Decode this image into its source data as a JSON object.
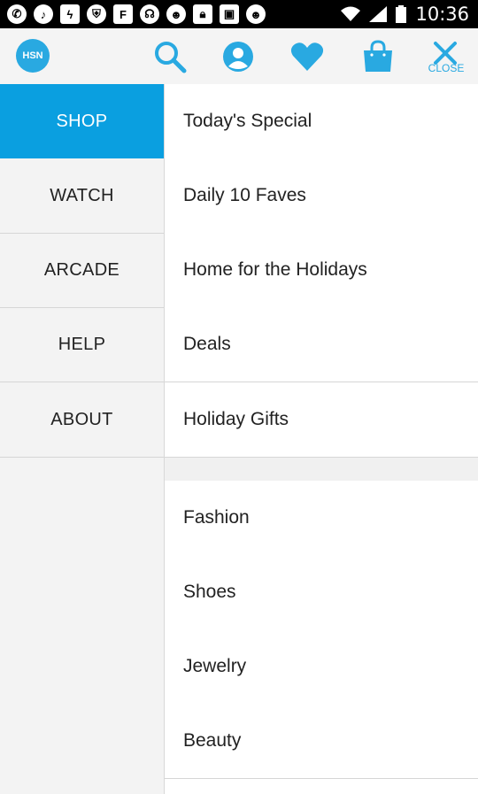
{
  "status_bar": {
    "time": "10:36",
    "notification_icons": [
      "whatsapp-icon",
      "music-icon",
      "bolt-icon",
      "shield-icon",
      "flipboard-icon",
      "headset-icon",
      "bot-icon",
      "lock-icon",
      "image-icon",
      "bot-icon"
    ]
  },
  "header": {
    "logo_text": "HSN",
    "close_label": "CLOSE",
    "accent_color": "#29a9e1"
  },
  "left_nav": [
    {
      "label": "SHOP",
      "active": true
    },
    {
      "label": "WATCH",
      "active": false
    },
    {
      "label": "ARCADE",
      "active": false
    },
    {
      "label": "HELP",
      "active": false
    },
    {
      "label": "ABOUT",
      "active": false
    }
  ],
  "right_list_top": [
    {
      "label": "Today's Special"
    },
    {
      "label": "Daily 10 Faves"
    },
    {
      "label": "Home for the Holidays"
    },
    {
      "label": "Deals"
    },
    {
      "label": "Holiday Gifts"
    }
  ],
  "right_list_bottom": [
    {
      "label": "Fashion"
    },
    {
      "label": "Shoes"
    },
    {
      "label": "Jewelry"
    },
    {
      "label": "Beauty"
    }
  ],
  "colors": {
    "active_tab": "#0a9fe0",
    "panel_bg": "#f3f3f3"
  }
}
